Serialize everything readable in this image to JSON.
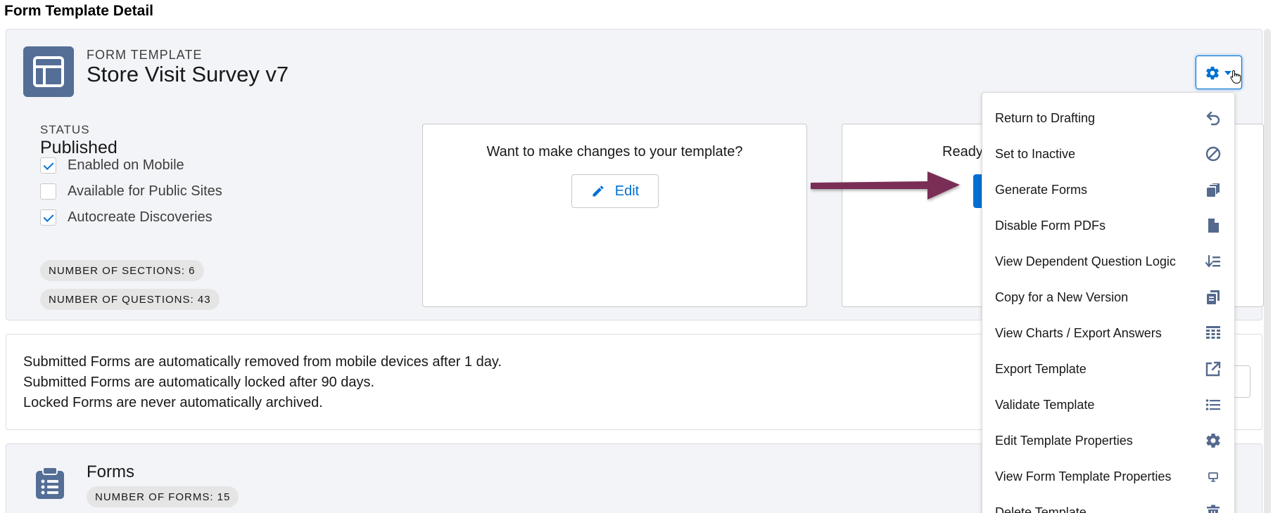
{
  "page": {
    "title": "Form Template Detail"
  },
  "header": {
    "type_label": "FORM TEMPLATE",
    "name": "Store Visit Survey v7",
    "status_label": "STATUS",
    "status_value": "Published",
    "checkboxes": [
      {
        "label": "Enabled on Mobile",
        "checked": true
      },
      {
        "label": "Available for Public Sites",
        "checked": false
      },
      {
        "label": "Autocreate Discoveries",
        "checked": true
      }
    ],
    "sections_count": "NUMBER OF SECTIONS: 6",
    "questions_count": "NUMBER OF QUESTIONS: 43"
  },
  "edit_card": {
    "question": "Want to make changes to your template?",
    "button_label": "Edit"
  },
  "publish_card": {
    "question": "Ready"
  },
  "info": {
    "lines": [
      "Submitted Forms are automatically removed from mobile devices after 1 day.",
      "Submitted Forms are automatically locked after 90 days.",
      "Locked Forms are never automatically archived."
    ]
  },
  "forms_section": {
    "title": "Forms",
    "count": "NUMBER OF FORMS: 15"
  },
  "menu": {
    "items": [
      {
        "label": "Return to Drafting",
        "icon": "undo-icon"
      },
      {
        "label": "Set to Inactive",
        "icon": "ban-icon"
      },
      {
        "label": "Generate Forms",
        "icon": "copy-stack-icon"
      },
      {
        "label": "Disable Form PDFs",
        "icon": "file-icon"
      },
      {
        "label": "View Dependent Question Logic",
        "icon": "sort-list-icon"
      },
      {
        "label": "Copy for a New Version",
        "icon": "copy-icon"
      },
      {
        "label": "View Charts / Export Answers",
        "icon": "table-icon"
      },
      {
        "label": "Export Template",
        "icon": "external-link-icon"
      },
      {
        "label": "Validate Template",
        "icon": "list-icon"
      },
      {
        "label": "Edit Template Properties",
        "icon": "gear-icon"
      },
      {
        "label": "View Form Template Properties",
        "icon": "monitor-icon"
      },
      {
        "label": "Delete Template",
        "icon": "trash-icon"
      }
    ]
  },
  "colors": {
    "brand": "#0070d2",
    "icon_bg": "#546e96",
    "menu_icon": "#54698d",
    "arrow": "#7a2e55"
  }
}
